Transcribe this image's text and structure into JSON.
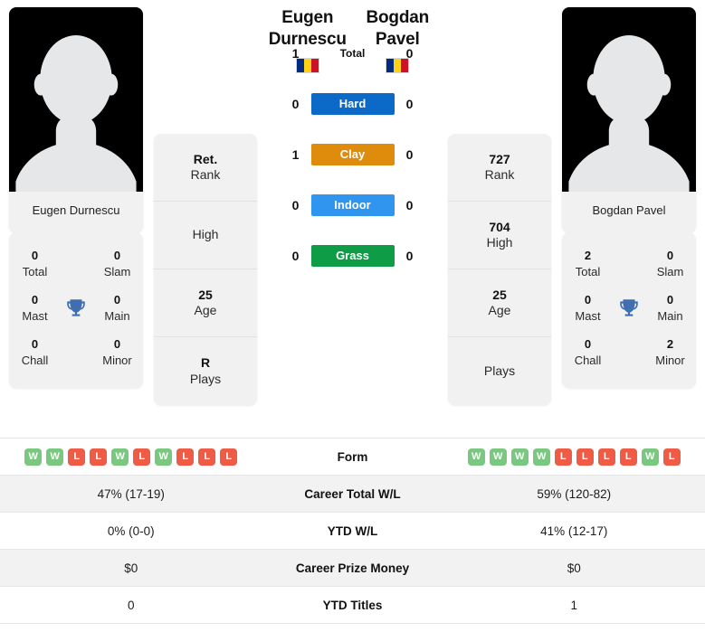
{
  "players": {
    "left": {
      "first_name": "Eugen",
      "last_name": "Durnescu",
      "full_name": "Eugen Durnescu",
      "country": "Romania",
      "flag_colors": [
        "#002b7f",
        "#fcd116",
        "#ce1126"
      ],
      "rank": "Ret.",
      "rank_label": "Rank",
      "high": "",
      "high_label": "High",
      "age": "25",
      "age_label": "Age",
      "plays": "R",
      "plays_label": "Plays",
      "titles": {
        "total": "0",
        "total_label": "Total",
        "slam": "0",
        "slam_label": "Slam",
        "mast": "0",
        "mast_label": "Mast",
        "main": "0",
        "main_label": "Main",
        "chall": "0",
        "chall_label": "Chall",
        "minor": "0",
        "minor_label": "Minor"
      },
      "form": [
        "W",
        "W",
        "L",
        "L",
        "W",
        "L",
        "W",
        "L",
        "L",
        "L"
      ],
      "career_wl": "47% (17-19)",
      "ytd_wl": "0% (0-0)",
      "career_prize_money": "$0",
      "ytd_titles": "0"
    },
    "right": {
      "first_name": "Bogdan",
      "last_name": "Pavel",
      "full_name": "Bogdan Pavel",
      "country": "Romania",
      "flag_colors": [
        "#002b7f",
        "#fcd116",
        "#ce1126"
      ],
      "rank": "727",
      "rank_label": "Rank",
      "high": "704",
      "high_label": "High",
      "age": "25",
      "age_label": "Age",
      "plays": "",
      "plays_label": "Plays",
      "titles": {
        "total": "2",
        "total_label": "Total",
        "slam": "0",
        "slam_label": "Slam",
        "mast": "0",
        "mast_label": "Mast",
        "main": "0",
        "main_label": "Main",
        "chall": "0",
        "chall_label": "Chall",
        "minor": "2",
        "minor_label": "Minor"
      },
      "form": [
        "W",
        "W",
        "W",
        "W",
        "L",
        "L",
        "L",
        "L",
        "W",
        "L"
      ],
      "career_wl": "59% (120-82)",
      "ytd_wl": "41% (12-17)",
      "career_prize_money": "$0",
      "ytd_titles": "1"
    }
  },
  "head_to_head": [
    {
      "label": "Total",
      "left": "1",
      "right": "0",
      "color": "",
      "style": "plain"
    },
    {
      "label": "Hard",
      "left": "0",
      "right": "0",
      "color": "#0b69c7",
      "style": "badge"
    },
    {
      "label": "Clay",
      "left": "1",
      "right": "0",
      "color": "#df8b0c",
      "style": "badge"
    },
    {
      "label": "Indoor",
      "left": "0",
      "right": "0",
      "color": "#2f95ef",
      "style": "badge"
    },
    {
      "label": "Grass",
      "left": "0",
      "right": "0",
      "color": "#0e9c46",
      "style": "badge"
    }
  ],
  "stats_rows": [
    {
      "label": "Form",
      "type": "form",
      "left_key": "form",
      "right_key": "form"
    },
    {
      "label": "Career Total W/L",
      "type": "text",
      "left": "47% (17-19)",
      "right": "59% (120-82)"
    },
    {
      "label": "YTD W/L",
      "type": "text",
      "left": "0% (0-0)",
      "right": "41% (12-17)"
    },
    {
      "label": "Career Prize Money",
      "type": "text",
      "left": "$0",
      "right": "$0"
    },
    {
      "label": "YTD Titles",
      "type": "text",
      "left": "0",
      "right": "1"
    }
  ],
  "colors": {
    "win_badge": "#7ac77f",
    "loss_badge": "#ef5b45",
    "card_bg": "#f1f1f1",
    "row_alt_bg": "#f2f2f2",
    "trophy": "#3f6fb0"
  }
}
